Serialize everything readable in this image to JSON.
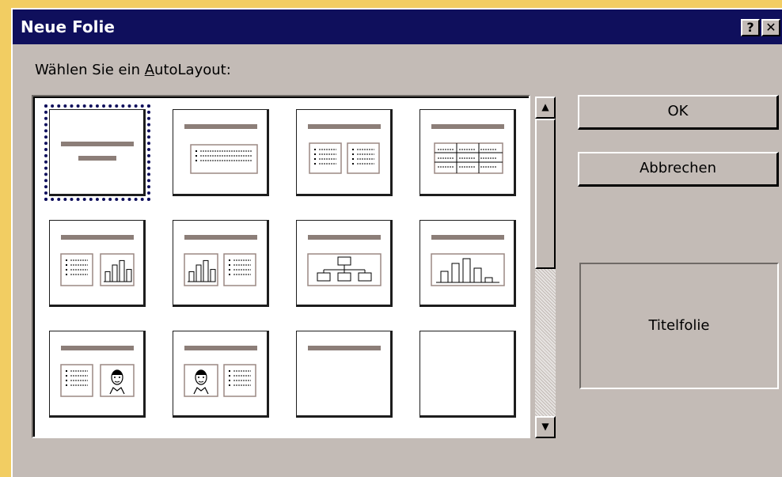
{
  "window": {
    "title": "Neue Folie",
    "help_label": "?",
    "close_label": "✕"
  },
  "prompt": {
    "before": "Wählen Sie ein ",
    "accel": "A",
    "after": "utoLayout:"
  },
  "buttons": {
    "ok": "OK",
    "cancel": "Abbrechen"
  },
  "preview": {
    "label": "Titelfolie"
  },
  "scrollbar": {
    "up": "▲",
    "down": "▼"
  },
  "layouts": [
    {
      "type": "title",
      "selected": true
    },
    {
      "type": "text"
    },
    {
      "type": "two-text"
    },
    {
      "type": "table"
    },
    {
      "type": "text-chart"
    },
    {
      "type": "chart-text"
    },
    {
      "type": "org-chart"
    },
    {
      "type": "chart"
    },
    {
      "type": "text-clipart"
    },
    {
      "type": "clipart-text"
    },
    {
      "type": "title-only"
    },
    {
      "type": "blank"
    }
  ],
  "colors": {
    "bar": "#8c7e78",
    "frame": "#9b8883",
    "titlebar": "#0f0f5c",
    "dialog": "#c3bbb6"
  }
}
